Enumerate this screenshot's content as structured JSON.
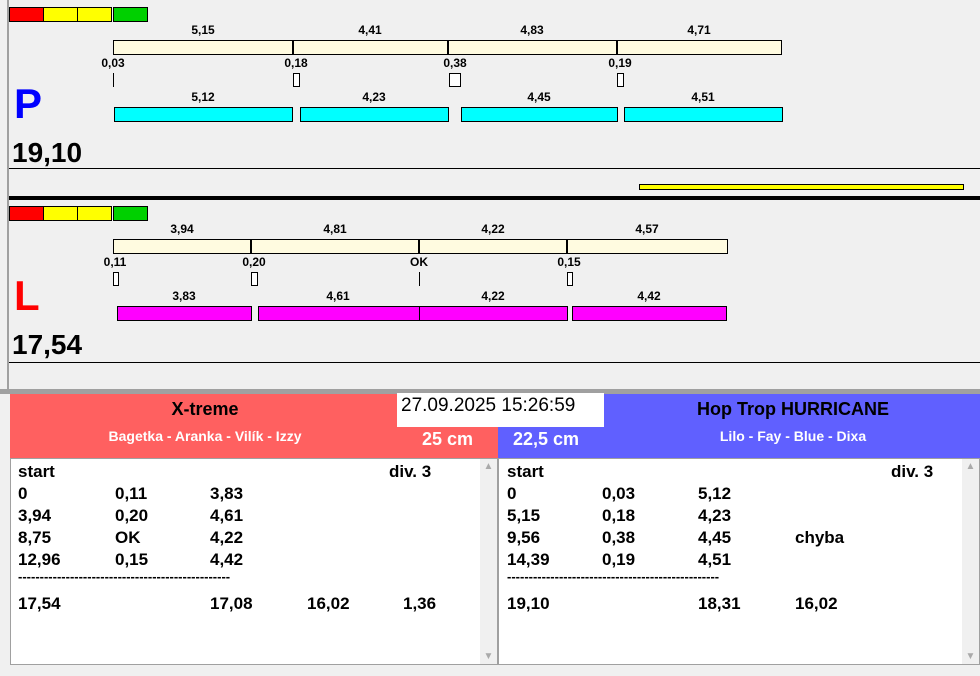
{
  "colors": {
    "red": "#ff0000",
    "yellow": "#ffff00",
    "green": "#00c800",
    "cream": "#fffbe0",
    "cyan": "#00ffff",
    "magenta": "#ff00ff",
    "team_left": "#ff6060",
    "team_right": "#6060ff"
  },
  "p": {
    "letter": "P",
    "total": "19,10",
    "top_labels": [
      "5,15",
      "4,41",
      "4,83",
      "4,71"
    ],
    "splits": [
      "0,03",
      "0,18",
      "0,38",
      "0,19"
    ],
    "bottom_labels": [
      "5,12",
      "4,23",
      "4,45",
      "4,51"
    ]
  },
  "l": {
    "letter": "L",
    "total": "17,54",
    "top_labels": [
      "3,94",
      "4,81",
      "4,22",
      "4,57"
    ],
    "splits": [
      "0,11",
      "0,20",
      "OK",
      "0,15"
    ],
    "bottom_labels": [
      "3,83",
      "4,61",
      "4,22",
      "4,42"
    ]
  },
  "datetime": "27.09.2025 15:26:59",
  "left_team": {
    "name": "X-treme",
    "dogs": "Bagetka - Aranka - Vilík - Izzy",
    "height": "25 cm",
    "header": [
      "start",
      "div.  3"
    ],
    "rows": [
      [
        "0",
        "0,11",
        "3,83",
        ""
      ],
      [
        "3,94",
        "0,20",
        "4,61",
        ""
      ],
      [
        "8,75",
        "OK",
        "4,22",
        ""
      ],
      [
        "12,96",
        "0,15",
        "4,42",
        ""
      ]
    ],
    "dashes": "-------------------------------------------------",
    "totals": [
      "17,54",
      "17,08",
      "16,02",
      "1,36"
    ]
  },
  "right_team": {
    "name": "Hop Trop HURRICANE",
    "dogs": "Lilo - Fay - Blue - Dixa",
    "height": "22,5 cm",
    "header": [
      "start",
      "div.  3"
    ],
    "rows": [
      [
        "0",
        "0,03",
        "5,12",
        ""
      ],
      [
        "5,15",
        "0,18",
        "4,23",
        ""
      ],
      [
        "9,56",
        "0,38",
        "4,45",
        "chyba"
      ],
      [
        "14,39",
        "0,19",
        "4,51",
        ""
      ]
    ],
    "dashes": "-------------------------------------------------",
    "totals": [
      "19,10",
      "18,31",
      "16,02",
      ""
    ]
  }
}
